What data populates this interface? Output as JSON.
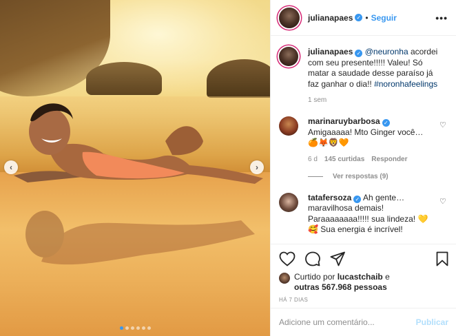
{
  "post": {
    "username": "julianapaes",
    "separator": "•",
    "follow_label": "Seguir",
    "more_label": "•••"
  },
  "caption": {
    "username": "julianapaes",
    "mention": "@neuronha",
    "text": " acordei com seu presente!!!!! Valeu! Só matar a saudade desse paraíso já faz ganhar o dia!! ",
    "hashtag": "#noronhafeelings",
    "time": "1 sem"
  },
  "comments": [
    {
      "username": "marinaruybarbosa",
      "text": "Amigaaaaa! Mto Ginger você…",
      "emoji": "🍊🦊🦁🧡",
      "time": "6 d",
      "likes": "145 curtidas",
      "reply_label": "Responder",
      "view_replies": "Ver respostas (9)"
    },
    {
      "username": "tatafersoza",
      "text": "Ah gente… maravilhosa demais! Paraaaaaaaa!!!!! sua lindeza! 💛 🥰 Sua energia é incrível!"
    }
  ],
  "likes": {
    "prefix": "Curtido por ",
    "first_user": "lucastchaib",
    "middle": " e",
    "others": "outras 567.968 pessoas"
  },
  "date": "HÁ 7 DIAS",
  "add_comment": {
    "placeholder": "Adicione um comentário...",
    "publish_label": "Publicar"
  },
  "carousel": {
    "prev_label": "‹",
    "next_label": "›",
    "slide_count": 6,
    "active_index": 0
  },
  "colors": {
    "accent": "#3897f0",
    "verified": "#3897f0",
    "muted": "#8e8e8e",
    "publish_disabled": "#b2dffc"
  }
}
